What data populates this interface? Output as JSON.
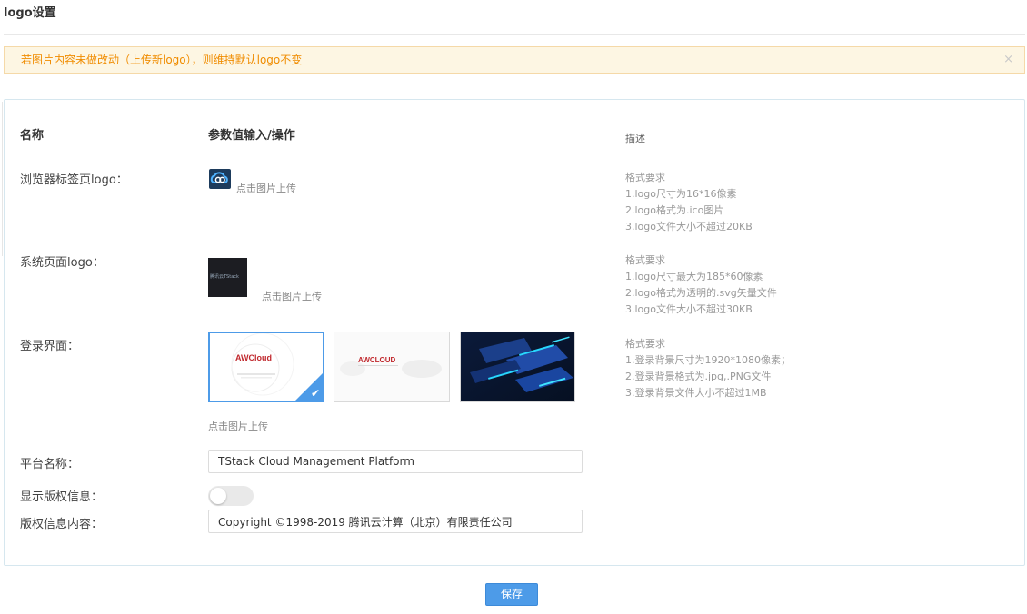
{
  "page": {
    "title": "logo设置"
  },
  "alert": {
    "message": "若图片内容未做改动（上传新logo），则维持默认logo不变",
    "close_icon": "×"
  },
  "table": {
    "col_name": "名称",
    "col_value": "参数值输入/操作",
    "col_desc": "描述"
  },
  "rows": {
    "favicon": {
      "label": "浏览器标签页logo：",
      "upload_text": "点击图片上传",
      "desc": [
        "格式要求",
        "1.logo尺寸为16*16像素",
        "2.logo格式为.ico图片",
        "3.logo文件大小不超过20KB"
      ]
    },
    "system_logo": {
      "label": "系统页面logo：",
      "upload_text": "点击图片上传",
      "logo_text": "腾讯云TStack",
      "desc": [
        "格式要求",
        "1.logo尺寸最大为185*60像素",
        "2.logo格式为透明的.svg矢量文件",
        "3.logo文件大小不超过30KB"
      ]
    },
    "login": {
      "label": "登录界面：",
      "upload_text": "点击图片上传",
      "thumb1_brand": "AWCloud",
      "thumb2_brand": "AWCLOUD",
      "selected_icon": "✔",
      "desc": [
        "格式要求",
        "1.登录背景尺寸为1920*1080像素；",
        "2.登录背景格式为.jpg,.PNG文件",
        "3.登录背景文件大小不超过1MB"
      ]
    },
    "platform_name": {
      "label": "平台名称：",
      "value": "TStack Cloud Management Platform"
    },
    "show_copyright": {
      "label": "显示版权信息：",
      "enabled": false
    },
    "copyright_content": {
      "label": "版权信息内容：",
      "value": "Copyright ©1998-2019 腾讯云计算（北京）有限责任公司"
    }
  },
  "actions": {
    "save_label": "保存"
  },
  "colors": {
    "accent": "#4d9be8",
    "alert_bg": "#fdf6e3",
    "alert_text": "#f08c00"
  }
}
